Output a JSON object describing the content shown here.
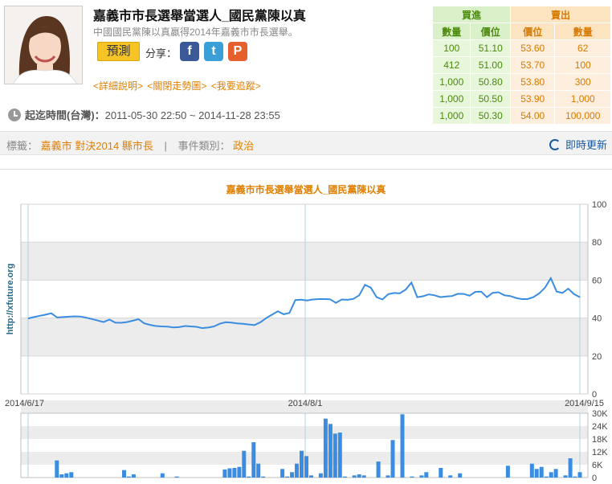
{
  "market": {
    "title": "嘉義市市長選舉當選人_國民黨陳以真",
    "subtitle": "中國國民黨陳以真贏得2014年嘉義市市長選舉。",
    "predict_label": "預測",
    "share_label": "分享：",
    "share_icons": [
      {
        "name": "facebook-icon",
        "glyph": "f",
        "color": "#3b5998"
      },
      {
        "name": "twitter-icon",
        "glyph": "t",
        "color": "#3a9fd6"
      },
      {
        "name": "plurk-icon",
        "glyph": "P",
        "color": "#e45f2b"
      }
    ],
    "links": [
      "<詳細說明>",
      "<關閉走勢圖>",
      "<我要追蹤>"
    ],
    "period_label": "起迄時間(台灣)：",
    "period_value": "2011-05-30 22:50 ~ 2014-11-28 23:55"
  },
  "orderbook": {
    "buy_header": "買進",
    "sell_header": "賣出",
    "columns": [
      "數量",
      "價位",
      "價位",
      "數量"
    ],
    "rows": [
      [
        "100",
        "51.10",
        "53.60",
        "62"
      ],
      [
        "412",
        "51.00",
        "53.70",
        "100"
      ],
      [
        "1,000",
        "50.80",
        "53.80",
        "300"
      ],
      [
        "1,000",
        "50.50",
        "53.90",
        "1,000"
      ],
      [
        "1,000",
        "50.30",
        "54.00",
        "100,000"
      ]
    ]
  },
  "tags": {
    "label": "標籤：",
    "values": [
      "嘉義市",
      "對決2014",
      "縣市長"
    ],
    "category_label": "事件類別：",
    "category_value": "政治",
    "refresh_label": "即時更新"
  },
  "colors": {
    "accent": "#e07f00",
    "line": "#3a8de0",
    "buy": "#4a8a0a",
    "sell": "#d97a00"
  },
  "chart_data": {
    "type": "line",
    "title": "嘉義市市長選舉當選人_國民黨陳以真",
    "watermark": "http://xfuture.org",
    "x_tick_labels": [
      "2014/6/17",
      "2014/8/1",
      "2014/9/15"
    ],
    "y_ticks": [
      0,
      20,
      40,
      60,
      80,
      100
    ],
    "ylim": [
      0,
      100
    ],
    "volume_ticks": [
      "0",
      "6K",
      "12K",
      "18K",
      "24K",
      "30K"
    ],
    "volume_ylim": [
      0,
      30000
    ],
    "grid": true,
    "price": [
      39.8,
      40.5,
      41.2,
      41.8,
      42.5,
      40.3,
      40.5,
      40.7,
      40.9,
      40.8,
      40.2,
      39.5,
      38.7,
      37.9,
      39.2,
      37.6,
      37.5,
      37.9,
      38.6,
      39.4,
      37.2,
      36.4,
      35.8,
      35.6,
      35.5,
      35.1,
      35.2,
      35.8,
      35.6,
      35.4,
      34.7,
      35.0,
      35.6,
      37.0,
      37.8,
      37.6,
      37.2,
      37.0,
      36.6,
      36.3,
      37.8,
      40.0,
      41.8,
      43.6,
      42.0,
      42.7,
      49.5,
      49.7,
      49.3,
      49.8,
      50.0,
      50.0,
      49.9,
      48.0,
      49.8,
      49.6,
      50.1,
      52.0,
      57.5,
      56.0,
      51.0,
      49.8,
      52.6,
      53.2,
      53.0,
      55.0,
      58.7,
      51.0,
      51.5,
      52.5,
      52.0,
      51.0,
      51.4,
      51.6,
      52.8,
      52.7,
      51.8,
      53.8,
      53.9,
      51.0,
      53.3,
      53.6,
      52.0,
      51.6,
      50.6,
      50.0,
      50.0,
      51.0,
      53.0,
      56.0,
      61.0,
      54.0,
      53.2,
      55.5,
      52.6,
      51.0
    ],
    "volume": [
      0,
      0,
      0,
      0,
      0,
      0,
      8000,
      1500,
      2000,
      2500,
      0,
      0,
      0,
      0,
      0,
      0,
      0,
      0,
      0,
      0,
      3500,
      500,
      1500,
      0,
      0,
      0,
      0,
      0,
      2000,
      0,
      0,
      500,
      0,
      0,
      0,
      0,
      0,
      0,
      0,
      0,
      0,
      3800,
      4300,
      4500,
      5000,
      12500,
      500,
      16500,
      6500,
      500,
      0,
      0,
      0,
      4000,
      500,
      2500,
      6500,
      12500,
      10000,
      1000,
      0,
      2000,
      27500,
      25000,
      20500,
      21000,
      500,
      0,
      1000,
      1500,
      1000,
      0,
      0,
      7500,
      0,
      1000,
      17500,
      0,
      29500,
      0,
      500,
      0,
      1000,
      2500,
      0,
      0,
      4500,
      0,
      1000,
      0,
      2000,
      0,
      0,
      0,
      0,
      0,
      0,
      0,
      0,
      0,
      5500,
      0,
      0,
      0,
      0,
      6500,
      4000,
      5000,
      500,
      2500,
      4000,
      0,
      1000,
      9000,
      500,
      2500
    ]
  }
}
